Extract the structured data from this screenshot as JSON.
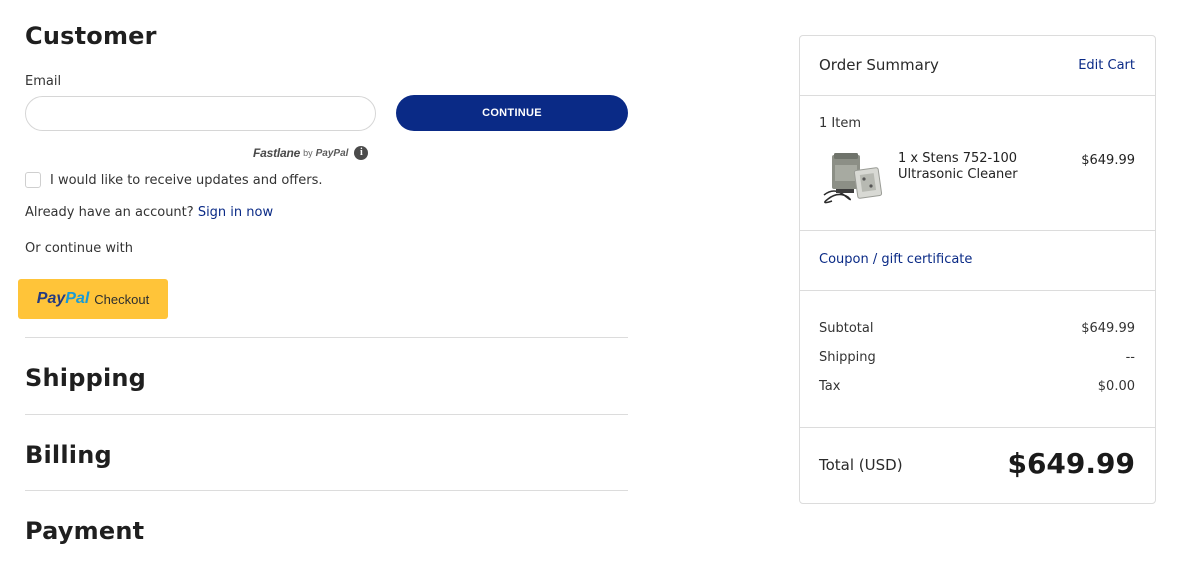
{
  "customer": {
    "title": "Customer",
    "email_label": "Email",
    "email_value": "",
    "continue_label": "CONTINUE",
    "fastlane": {
      "word": "Fastlane",
      "by": "by",
      "paypal": "PayPal"
    },
    "updates_label": "I would like to receive updates and offers.",
    "account_prompt": "Already have an account?",
    "signin_label": "Sign in now",
    "or_continue": "Or continue with",
    "paypal_button": {
      "pay": "Pay",
      "pal": "Pal",
      "checkout": "Checkout"
    }
  },
  "sections": {
    "shipping": "Shipping",
    "billing": "Billing",
    "payment": "Payment"
  },
  "summary": {
    "title": "Order Summary",
    "edit_cart": "Edit Cart",
    "item_count": "1 Item",
    "item": {
      "name": "1 x Stens 752-100 Ultrasonic Cleaner",
      "price": "$649.99"
    },
    "coupon_label": "Coupon / gift certificate",
    "subtotal_label": "Subtotal",
    "subtotal_value": "$649.99",
    "shipping_label": "Shipping",
    "shipping_value": "--",
    "tax_label": "Tax",
    "tax_value": "$0.00",
    "total_label": "Total (USD)",
    "total_value": "$649.99"
  },
  "colors": {
    "primary": "#0a2a86",
    "paypal_yellow": "#ffc439",
    "paypal_dark_blue": "#253b80",
    "paypal_light_blue": "#179bd7"
  },
  "icons": {
    "fastlane_info": "info-icon",
    "product": "ultrasonic-cleaner-thumbnail"
  }
}
